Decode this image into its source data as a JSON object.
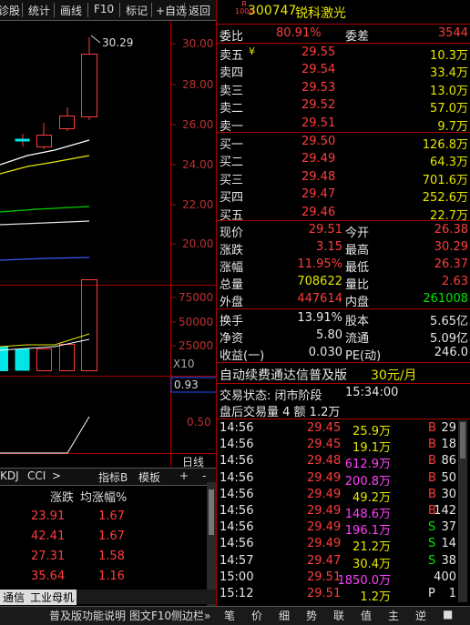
{
  "toolbar": {
    "items": [
      "诊股",
      "统计",
      "画线",
      "F10",
      "标记",
      "+自选",
      "返回"
    ]
  },
  "stock": {
    "badge_top": "R",
    "badge_bot": "1000",
    "code": "300747",
    "name": "锐科激光"
  },
  "price_axis": [
    "30.00",
    "28.00",
    "26.00",
    "24.00",
    "22.00",
    "20.00"
  ],
  "high_marker": "30.29",
  "vol_axis": [
    "75000",
    "50000",
    "25000"
  ],
  "vol_tag": "X10",
  "ind_axis": {
    "value": "0.93",
    "mid": "0.50"
  },
  "period": "日线",
  "ind_tabs": [
    "KDJ",
    "CCI",
    ">",
    "指标B",
    "模板",
    "+",
    "-"
  ],
  "table": {
    "headers": [
      "涨跌",
      "均涨幅%"
    ],
    "rows": [
      [
        "23.91",
        "1.67"
      ],
      [
        "42.41",
        "1.67"
      ],
      [
        "27.31",
        "1.58"
      ],
      [
        "35.64",
        "1.16"
      ]
    ]
  },
  "sheet_tabs": [
    "通信",
    "工业母机"
  ],
  "bottom_bar": {
    "help": "普及版功能说明",
    "f10": "图文F10",
    "side": "侧边栏»"
  },
  "weibi": {
    "label": "委比",
    "value": "80.91%",
    "label2": "委差",
    "value2": "3544"
  },
  "asks": [
    {
      "label": "卖五",
      "flag": "¥",
      "price": "29.55",
      "vol": "10.3万"
    },
    {
      "label": "卖四",
      "flag": "",
      "price": "29.54",
      "vol": "33.4万"
    },
    {
      "label": "卖三",
      "flag": "",
      "price": "29.53",
      "vol": "13.0万"
    },
    {
      "label": "卖二",
      "flag": "",
      "price": "29.52",
      "vol": "57.0万"
    },
    {
      "label": "卖一",
      "flag": "",
      "price": "29.51",
      "vol": "9.7万"
    }
  ],
  "bids": [
    {
      "label": "买一",
      "price": "29.50",
      "vol": "126.8万"
    },
    {
      "label": "买二",
      "price": "29.49",
      "vol": "64.3万"
    },
    {
      "label": "买三",
      "price": "29.48",
      "vol": "701.6万"
    },
    {
      "label": "买四",
      "price": "29.47",
      "vol": "252.6万"
    },
    {
      "label": "买五",
      "price": "29.46",
      "vol": "22.7万"
    }
  ],
  "quote": [
    {
      "l1": "现价",
      "v1": "29.51",
      "l2": "今开",
      "v2": "26.38"
    },
    {
      "l1": "涨跌",
      "v1": "3.15",
      "l2": "最高",
      "v2": "30.29"
    },
    {
      "l1": "涨幅",
      "v1": "11.95%",
      "l2": "最低",
      "v2": "26.37"
    },
    {
      "l1": "总量",
      "v1": "708622",
      "l2": "量比",
      "v2": "2.63"
    },
    {
      "l1": "外盘",
      "v1": "447614",
      "l2": "内盘",
      "v2": "261008"
    }
  ],
  "fund": [
    {
      "l1": "换手",
      "v1": "13.91%",
      "l2": "股本",
      "v2": "5.65亿"
    },
    {
      "l1": "净资",
      "v1": "5.80",
      "l2": "流通",
      "v2": "5.09亿"
    },
    {
      "l1": "收益(一)",
      "v1": "0.030",
      "l2": "PE(动)",
      "v2": "246.0"
    }
  ],
  "promo": {
    "text": "自动续费通达信普及版",
    "price": "30元/月"
  },
  "status": {
    "label": "交易状态: 闭市阶段",
    "time": "15:34:00"
  },
  "after": "盘后交易量 4 额 1.2万",
  "ticks": [
    {
      "t": "14:56",
      "p": "29.45",
      "v": "25.9万",
      "s": "B",
      "n": "29"
    },
    {
      "t": "14:56",
      "p": "29.45",
      "v": "19.1万",
      "s": "B",
      "n": "18"
    },
    {
      "t": "14:56",
      "p": "29.48",
      "v": "612.9万",
      "s": "B",
      "n": "86"
    },
    {
      "t": "14:56",
      "p": "29.49",
      "v": "200.8万",
      "s": "B",
      "n": "50"
    },
    {
      "t": "14:56",
      "p": "29.49",
      "v": "49.2万",
      "s": "B",
      "n": "30"
    },
    {
      "t": "14:56",
      "p": "29.49",
      "v": "148.6万",
      "s": "B",
      "n": "142"
    },
    {
      "t": "14:56",
      "p": "29.49",
      "v": "196.1万",
      "s": "S",
      "n": "37"
    },
    {
      "t": "14:56",
      "p": "29.49",
      "v": "21.2万",
      "s": "S",
      "n": "14"
    },
    {
      "t": "14:57",
      "p": "29.47",
      "v": "30.4万",
      "s": "S",
      "n": "38"
    },
    {
      "t": "15:00",
      "p": "29.51",
      "v": "1850.0万",
      "s": "",
      "n": "400"
    },
    {
      "t": "15:12",
      "p": "29.51",
      "v": "1.2万",
      "s": "P",
      "n": "1"
    }
  ],
  "bottom_tabs": [
    "笔",
    "价",
    "细",
    "势",
    "联",
    "值",
    "主",
    "逆",
    "■"
  ]
}
